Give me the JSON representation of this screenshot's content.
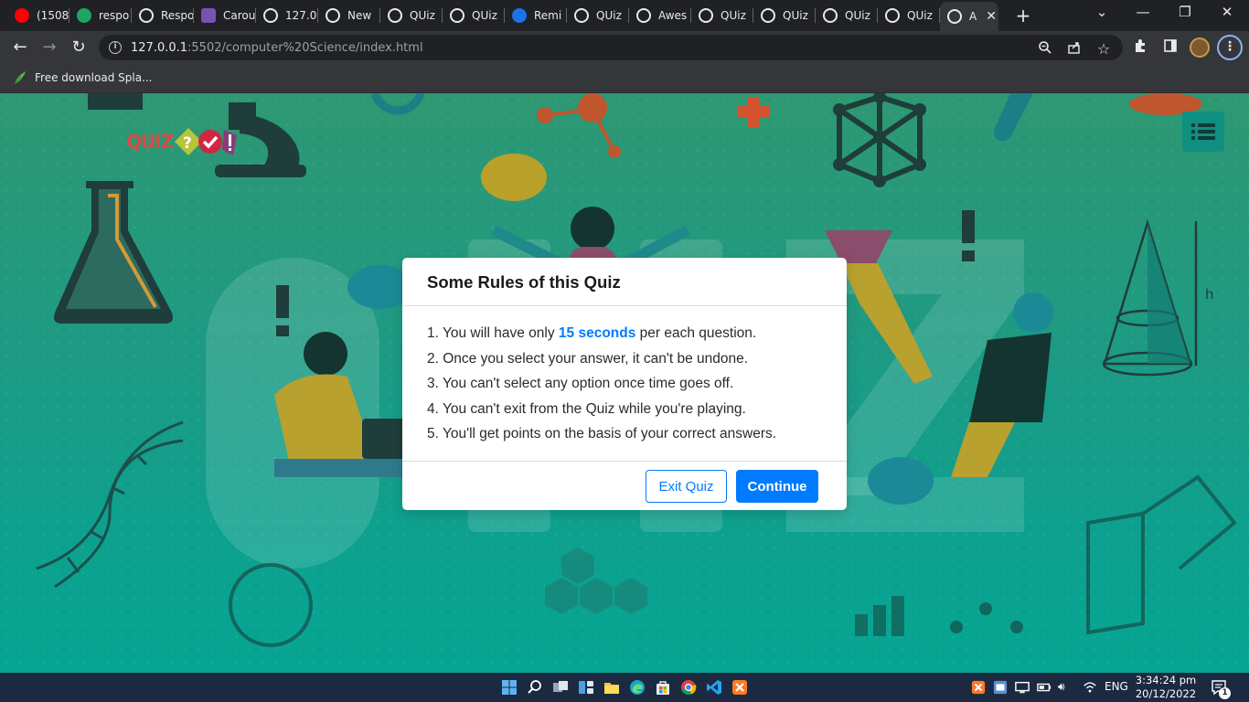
{
  "browser": {
    "tabs": [
      {
        "label": "(1508",
        "icon": "youtube-icon",
        "color": "#ff0000"
      },
      {
        "label": "respo",
        "icon": "google-drive-icon",
        "color": "#1fa463"
      },
      {
        "label": "Respo",
        "icon": "globe-icon",
        "color": "#e8eaed"
      },
      {
        "label": "Carou",
        "icon": "bootstrap-icon",
        "color": "#7952b3"
      },
      {
        "label": "127.0",
        "icon": "globe-icon",
        "color": "#e8eaed"
      },
      {
        "label": "New",
        "icon": "chrome-icon",
        "color": "#e8eaed"
      },
      {
        "label": "QUiz",
        "icon": "globe-icon",
        "color": "#e8eaed"
      },
      {
        "label": "QUiz",
        "icon": "globe-icon",
        "color": "#e8eaed"
      },
      {
        "label": "Remi",
        "icon": "reminder-icon",
        "color": "#1a73e8"
      },
      {
        "label": "QUiz",
        "icon": "globe-icon",
        "color": "#e8eaed"
      },
      {
        "label": "Awes",
        "icon": "globe-icon",
        "color": "#e8eaed"
      },
      {
        "label": "QUiz",
        "icon": "globe-icon",
        "color": "#e8eaed"
      },
      {
        "label": "QUiz",
        "icon": "globe-icon",
        "color": "#e8eaed"
      },
      {
        "label": "QUiz",
        "icon": "globe-icon",
        "color": "#e8eaed"
      },
      {
        "label": "QUiz",
        "icon": "globe-icon",
        "color": "#e8eaed"
      },
      {
        "label": "A",
        "icon": "globe-icon",
        "color": "#e8eaed",
        "active": true
      }
    ],
    "url_host": "127.0.0.1",
    "url_path": ":5502/computer%20Science/index.html",
    "bookmark_label": "Free download Spla..."
  },
  "page": {
    "logo_text": "QUIZ",
    "dialog": {
      "title": "Some Rules of this Quiz",
      "rules": [
        {
          "prefix": "1. You will have only ",
          "highlight": "15 seconds",
          "suffix": " per each question."
        },
        {
          "prefix": "2. Once you select your answer, it can't be undone.",
          "highlight": "",
          "suffix": ""
        },
        {
          "prefix": "3. You can't select any option once time goes off.",
          "highlight": "",
          "suffix": ""
        },
        {
          "prefix": "4. You can't exit from the Quiz while you're playing.",
          "highlight": "",
          "suffix": ""
        },
        {
          "prefix": "5. You'll get points on the basis of your correct answers.",
          "highlight": "",
          "suffix": ""
        }
      ],
      "exit_label": "Exit Quiz",
      "continue_label": "Continue"
    },
    "background_text": "QUIZ",
    "cone_label": "h",
    "accent_color": "#007bff"
  },
  "taskbar": {
    "language": "ENG",
    "time": "3:34:24 pm",
    "date": "20/12/2022",
    "notification_count": "1"
  }
}
